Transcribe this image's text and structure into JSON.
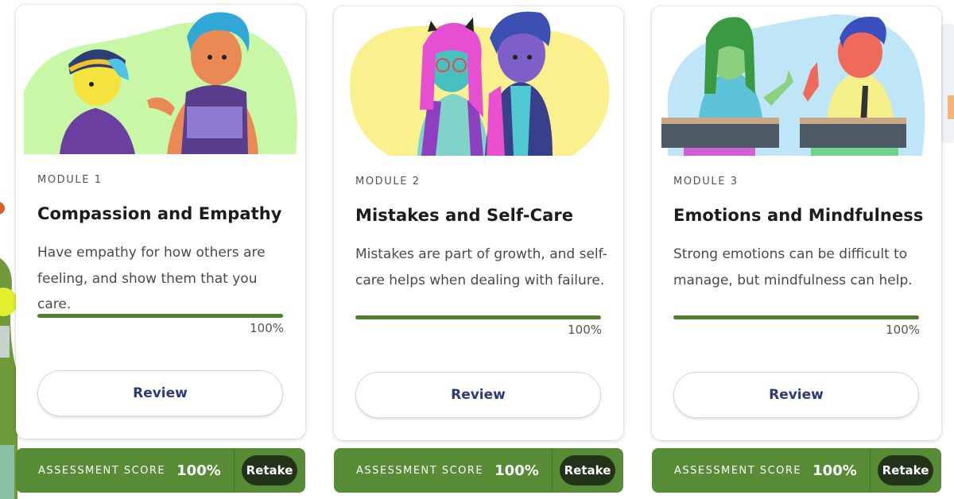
{
  "modules": [
    {
      "module_label": "MODULE 1",
      "title": "Compassion and Empathy",
      "description": "Have empathy for how others are feeling, and show them that you care.",
      "progress_text": "100%",
      "progress": 1.0,
      "review_label": "Review",
      "assessment_label": "ASSESSMENT SCORE",
      "assessment_score": "100%",
      "retake_label": "Retake",
      "illustration_bg": "#c8f7a6"
    },
    {
      "module_label": "MODULE 2",
      "title": "Mistakes and Self-Care",
      "description": "Mistakes are part of growth, and self-care helps when dealing with failure.",
      "progress_text": "100%",
      "progress": 1.0,
      "review_label": "Review",
      "assessment_label": "ASSESSMENT SCORE",
      "assessment_score": "100%",
      "retake_label": "Retake",
      "illustration_bg": "#fbf08e"
    },
    {
      "module_label": "MODULE 3",
      "title": "Emotions and Mindfulness",
      "description": "Strong emotions can be difficult to manage, but mindfulness can help.",
      "progress_text": "100%",
      "progress": 1.0,
      "review_label": "Review",
      "assessment_label": "ASSESSMENT SCORE",
      "assessment_score": "100%",
      "retake_label": "Retake",
      "illustration_bg": "#bfe6f8"
    }
  ],
  "colors": {
    "progress_fill": "#4f7f2f",
    "assessment_bar": "#588b36",
    "retake_button": "#23331a",
    "review_text": "#2c3a7c"
  }
}
